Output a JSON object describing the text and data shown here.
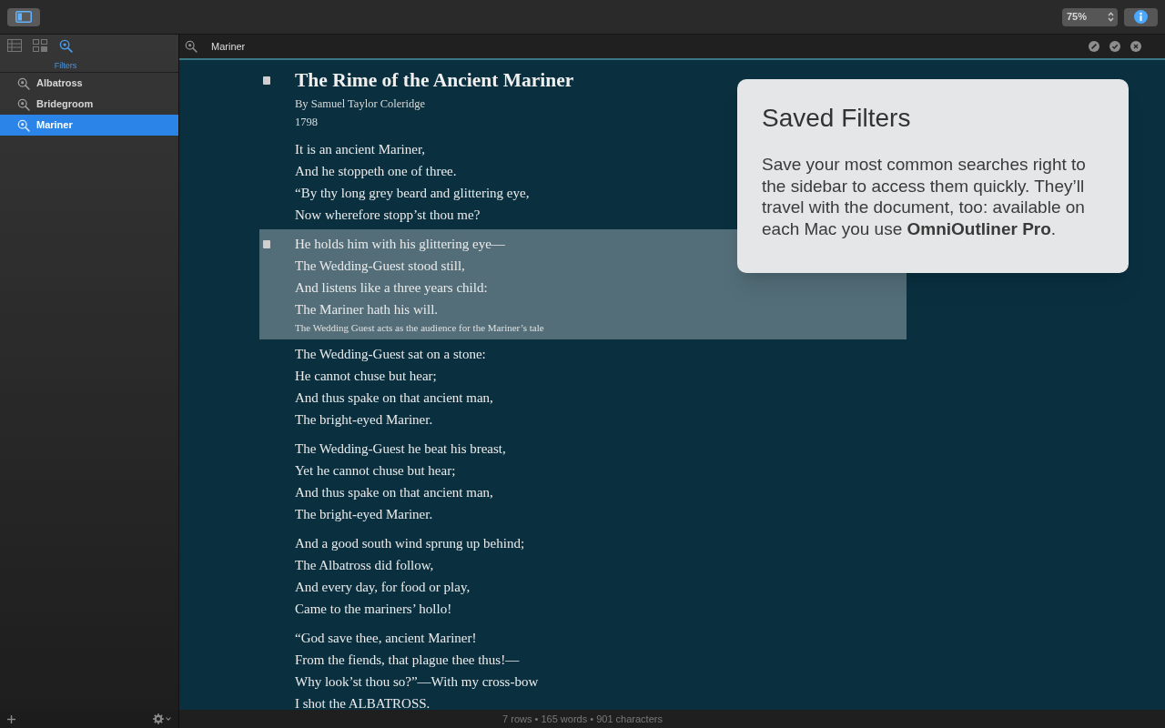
{
  "toolbar": {
    "zoom": "75%"
  },
  "sidebar": {
    "tabs": [
      {
        "selected": false
      },
      {
        "selected": false
      },
      {
        "label": "Filters",
        "selected": true
      }
    ],
    "filters": [
      {
        "label": "Albatross",
        "selected": false
      },
      {
        "label": "Bridegroom",
        "selected": false
      },
      {
        "label": "Mariner",
        "selected": true
      }
    ]
  },
  "search": {
    "value": "Mariner"
  },
  "outline": {
    "rows": [
      {
        "kind": "heading",
        "selected": false,
        "lines": [
          "The Rime of the Ancient Mariner"
        ],
        "note": [
          "By Samuel Taylor Coleridge",
          "1798"
        ]
      },
      {
        "kind": "stanza",
        "selected": false,
        "lines": [
          "It is an ancient Mariner,",
          "And he stoppeth one of three.",
          "“By thy long grey beard and glittering eye,",
          "Now wherefore stopp’st thou me?"
        ]
      },
      {
        "kind": "stanza",
        "selected": true,
        "lines": [
          "He holds him with his glittering eye—",
          "The Wedding-Guest stood still,",
          "And listens like a three years child:",
          "The Mariner hath his will."
        ],
        "note": [
          "The Wedding Guest acts as the audience for the Mariner’s tale"
        ]
      },
      {
        "kind": "stanza",
        "selected": false,
        "lines": [
          "The Wedding-Guest sat on a stone:",
          "He cannot chuse but hear;",
          "And thus spake on that ancient man,",
          "The bright-eyed Mariner."
        ]
      },
      {
        "kind": "stanza",
        "selected": false,
        "lines": [
          "The Wedding-Guest he beat his breast,",
          "Yet he cannot chuse but hear;",
          "And thus spake on that ancient man,",
          "The bright-eyed Mariner."
        ]
      },
      {
        "kind": "stanza",
        "selected": false,
        "lines": [
          "And a good south wind sprung up behind;",
          "The Albatross did follow,",
          "And every day, for food or play,",
          "Came to the mariners’ hollo!"
        ]
      },
      {
        "kind": "stanza",
        "selected": false,
        "lines": [
          "“God save thee, ancient Mariner!",
          "From the fiends, that plague thee thus!—",
          "Why look’st thou so?”—With my cross-bow",
          "I shot the ALBATROSS."
        ]
      }
    ]
  },
  "popover": {
    "title": "Saved Filters",
    "text": "Save your most common searches right to the sidebar to access them quickly. They’ll travel with the document, too: available on each Mac you use **OmniOutliner Pro**."
  },
  "status_bar": "7 rows • 165 words • 901 characters"
}
